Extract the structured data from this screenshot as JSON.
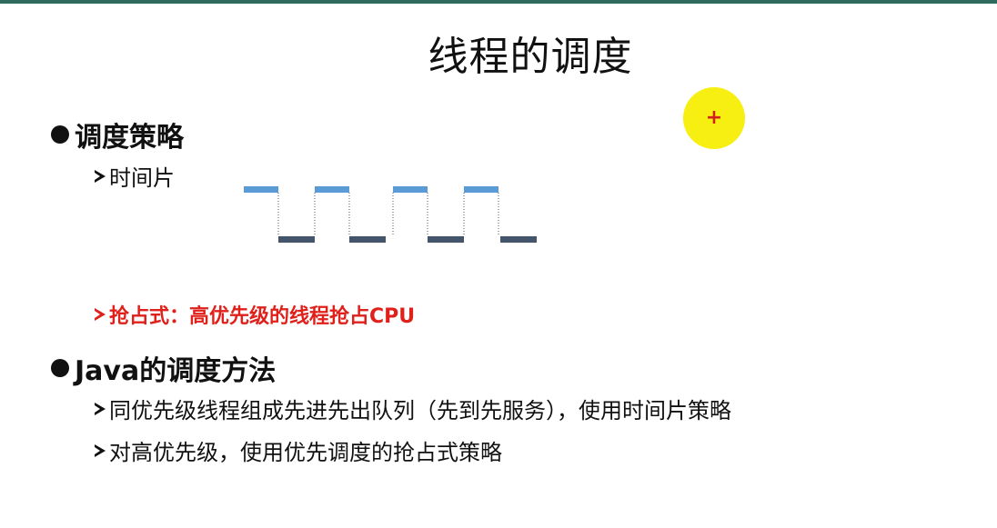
{
  "slide": {
    "title": "线程的调度",
    "sections": [
      {
        "heading": "调度策略",
        "items": [
          {
            "text": "时间片"
          },
          {
            "text": "抢占式：高优先级的线程抢占CPU"
          }
        ]
      },
      {
        "heading": "Java的调度方法",
        "items": [
          {
            "text": "同优先级线程组成先进先出队列（先到先服务），使用时间片策略"
          },
          {
            "text": "对高优先级，使用优先调度的抢占式策略"
          }
        ]
      }
    ]
  },
  "colors": {
    "high_segment": "#5b9bd5",
    "low_segment": "#44546a",
    "emphasis_text": "#e0201a",
    "cursor_highlight": "#f7ee12",
    "top_bar": "#2f6a5c"
  },
  "icons": {
    "bullet": "filled-circle-icon",
    "sub_bullet": "arrowhead-icon",
    "cursor": "pointer-highlight-icon"
  }
}
